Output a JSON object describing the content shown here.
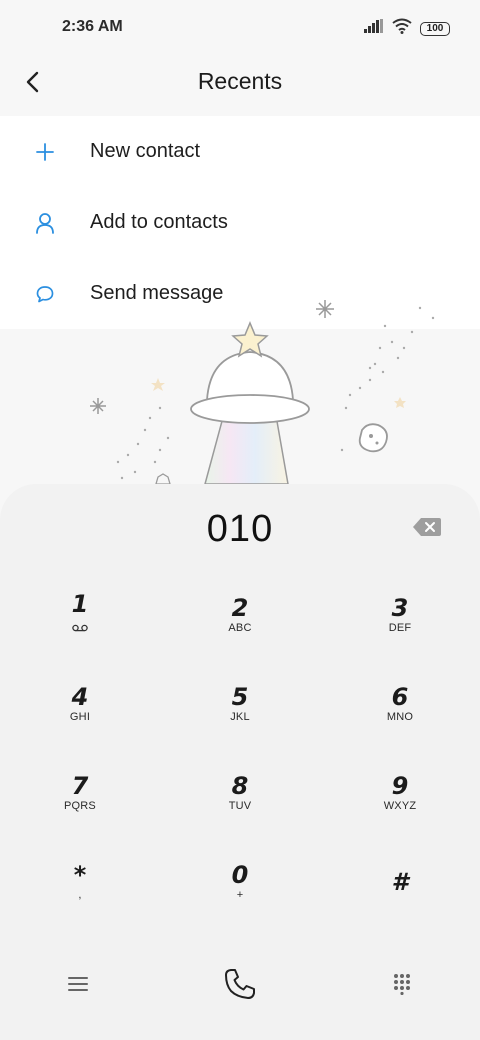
{
  "status_bar": {
    "time": "2:36 AM",
    "battery": "100"
  },
  "header": {
    "title": "Recents"
  },
  "actions": [
    {
      "label": "New contact",
      "icon": "plus-icon"
    },
    {
      "label": "Add to contacts",
      "icon": "person-icon"
    },
    {
      "label": "Send message",
      "icon": "message-bubble-icon"
    }
  ],
  "dialpad": {
    "number": "010",
    "keys": [
      {
        "digit": "1",
        "letters": ""
      },
      {
        "digit": "2",
        "letters": "ABC"
      },
      {
        "digit": "3",
        "letters": "DEF"
      },
      {
        "digit": "4",
        "letters": "GHI"
      },
      {
        "digit": "5",
        "letters": "JKL"
      },
      {
        "digit": "6",
        "letters": "MNO"
      },
      {
        "digit": "7",
        "letters": "PQRS"
      },
      {
        "digit": "8",
        "letters": "TUV"
      },
      {
        "digit": "9",
        "letters": "WXYZ"
      },
      {
        "digit": "*",
        "letters": ","
      },
      {
        "digit": "0",
        "letters": "+"
      },
      {
        "digit": "#",
        "letters": ""
      }
    ]
  },
  "colors": {
    "accent": "#2b8fe0",
    "background": "#f7f7f7",
    "sheet": "#f2f2f2"
  }
}
